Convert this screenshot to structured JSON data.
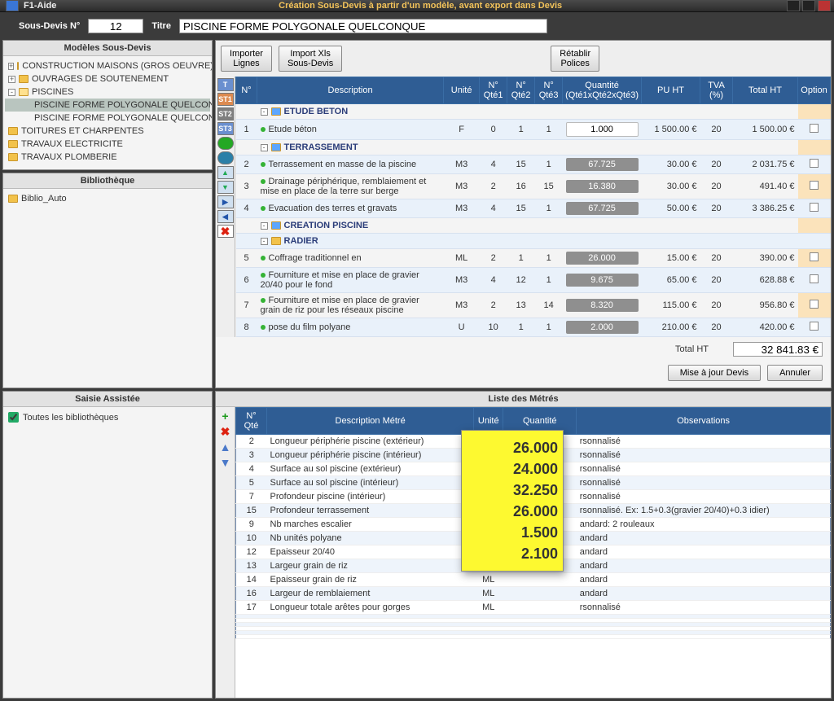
{
  "window": {
    "app": "F1-Aide",
    "title": "Création Sous-Devis à partir d'un modèle, avant export dans Devis"
  },
  "form": {
    "sdLabel": "Sous-Devis N°",
    "sdNum": "12",
    "titreLabel": "Titre",
    "titre": "PISCINE FORME POLYGONALE QUELCONQUE"
  },
  "left": {
    "modelsHeader": "Modèles Sous-Devis",
    "models": [
      {
        "t": "CONSTRUCTION MAISONS (GROS OEUVRE)",
        "ic": "folder",
        "ind": 0,
        "exp": "+"
      },
      {
        "t": "OUVRAGES DE SOUTENEMENT",
        "ic": "folder",
        "ind": 0,
        "exp": "+"
      },
      {
        "t": "PISCINES",
        "ic": "folder-open",
        "ind": 0,
        "exp": "-"
      },
      {
        "t": "PISCINE FORME POLYGONALE QUELCONQUE",
        "ic": "dot",
        "ind": 2,
        "sel": true
      },
      {
        "t": "PISCINE FORME POLYGONALE QUELCONQUE (BAS",
        "ic": "dot",
        "ind": 2
      },
      {
        "t": "TOITURES ET CHARPENTES",
        "ic": "folder",
        "ind": 0
      },
      {
        "t": "TRAVAUX ELECTRICITE",
        "ic": "folder",
        "ind": 0
      },
      {
        "t": "TRAVAUX PLOMBERIE",
        "ic": "folder",
        "ind": 0
      }
    ],
    "biblioHeader": "Bibliothèque",
    "biblio": [
      {
        "t": "Biblio_Auto",
        "ic": "folder"
      }
    ]
  },
  "toolbar": {
    "importL1": "Importer",
    "importL2": "Lignes",
    "importX1": "Import Xls",
    "importX2": "Sous-Devis",
    "retab1": "Rétablir",
    "retab2": "Polices"
  },
  "devis": {
    "headers": [
      "N°",
      "Description",
      "Unité",
      "N° Qté1",
      "N° Qté2",
      "N° Qté3",
      "Quantité (Qté1xQté2xQté3)",
      "PU HT",
      "TVA (%)",
      "Total HT",
      "Option"
    ],
    "rows": [
      {
        "type": "grp",
        "desc": "ETUDE BETON"
      },
      {
        "n": "1",
        "type": "line",
        "desc": "Etude béton",
        "u": "F",
        "q1": "0",
        "q2": "1",
        "q3": "1",
        "qt": "1.000",
        "qtw": true,
        "pu": "1 500.00 €",
        "tva": "20",
        "tot": "1 500.00 €"
      },
      {
        "type": "grp",
        "desc": "TERRASSEMENT"
      },
      {
        "n": "2",
        "type": "line",
        "desc": "Terrassement en masse de la piscine",
        "u": "M3",
        "q1": "4",
        "q2": "15",
        "q3": "1",
        "qt": "67.725",
        "pu": "30.00 €",
        "tva": "20",
        "tot": "2 031.75 €"
      },
      {
        "n": "3",
        "type": "line",
        "desc": "Drainage périphérique, remblaiement et mise en place de la terre sur berge",
        "u": "M3",
        "q1": "2",
        "q2": "16",
        "q3": "15",
        "qt": "16.380",
        "pu": "30.00 €",
        "tva": "20",
        "tot": "491.40 €"
      },
      {
        "n": "4",
        "type": "line",
        "desc": "Evacuation des terres et gravats",
        "u": "M3",
        "q1": "4",
        "q2": "15",
        "q3": "1",
        "qt": "67.725",
        "pu": "50.00 €",
        "tva": "20",
        "tot": "3 386.25 €"
      },
      {
        "type": "grp",
        "desc": "CREATION PISCINE"
      },
      {
        "type": "sub",
        "desc": "RADIER"
      },
      {
        "n": "5",
        "type": "line",
        "desc": "Coffrage traditionnel en",
        "u": "ML",
        "q1": "2",
        "q2": "1",
        "q3": "1",
        "qt": "26.000",
        "pu": "15.00 €",
        "tva": "20",
        "tot": "390.00 €"
      },
      {
        "n": "6",
        "type": "line",
        "desc": "Fourniture et mise en place de gravier 20/40 pour le fond",
        "u": "M3",
        "q1": "4",
        "q2": "12",
        "q3": "1",
        "qt": "9.675",
        "pu": "65.00 €",
        "tva": "20",
        "tot": "628.88 €"
      },
      {
        "n": "7",
        "type": "line",
        "desc": "Fourniture et mise en place de gravier grain de riz pour les réseaux piscine",
        "u": "M3",
        "q1": "2",
        "q2": "13",
        "q3": "14",
        "qt": "8.320",
        "pu": "115.00 €",
        "tva": "20",
        "tot": "956.80 €"
      },
      {
        "n": "8",
        "type": "line",
        "desc": "pose du film polyane",
        "u": "U",
        "q1": "10",
        "q2": "1",
        "q3": "1",
        "qt": "2.000",
        "pu": "210.00 €",
        "tva": "20",
        "tot": "420.00 €"
      }
    ],
    "totalLabel": "Total HT",
    "totalValue": "32 841.83 €",
    "btnUpdate": "Mise à jour Devis",
    "btnCancel": "Annuler"
  },
  "saisie": {
    "header": "Saisie Assistée",
    "chkLabel": "Toutes les bibliothèques"
  },
  "metres": {
    "header": "Liste des Métrés",
    "cols": [
      "N° Qté",
      "Description Métré",
      "Unité",
      "Quantité",
      "Observations"
    ],
    "rows": [
      {
        "n": "2",
        "d": "Longueur périphérie piscine (extérieur)",
        "u": "ML",
        "o": "rsonnalisé"
      },
      {
        "n": "3",
        "d": "Longueur périphérie piscine (intérieur)",
        "u": "ML",
        "o": "rsonnalisé"
      },
      {
        "n": "4",
        "d": "Surface au sol piscine (extérieur)",
        "u": "M2",
        "o": "rsonnalisé"
      },
      {
        "n": "5",
        "d": "Surface au sol piscine (intérieur)",
        "u": "M2",
        "o": "rsonnalisé"
      },
      {
        "n": "7",
        "d": "Profondeur piscine (intérieur)",
        "u": "ML",
        "o": "rsonnalisé"
      },
      {
        "n": "15",
        "d": "Profondeur terrassement",
        "u": "ML",
        "o": "rsonnalisé. Ex: 1.5+0.3(gravier 20/40)+0.3 idier)"
      },
      {
        "n": "9",
        "d": "Nb marches escalier",
        "u": "U",
        "o": "andard: 2 rouleaux"
      },
      {
        "n": "10",
        "d": "Nb unités polyane",
        "u": "U",
        "o": "andard"
      },
      {
        "n": "12",
        "d": "Epaisseur 20/40",
        "u": "ML",
        "o": "andard"
      },
      {
        "n": "13",
        "d": "Largeur grain de riz",
        "u": "ML",
        "o": "andard"
      },
      {
        "n": "14",
        "d": "Epaisseur grain de riz",
        "u": "ML",
        "o": "andard"
      },
      {
        "n": "16",
        "d": "Largeur de remblaiement",
        "u": "ML",
        "o": "andard"
      },
      {
        "n": "17",
        "d": "Longueur totale arêtes pour gorges",
        "u": "ML",
        "o": "rsonnalisé"
      }
    ],
    "yellow": [
      "26.000",
      "24.000",
      "32.250",
      "26.000",
      "1.500",
      "2.100"
    ]
  }
}
